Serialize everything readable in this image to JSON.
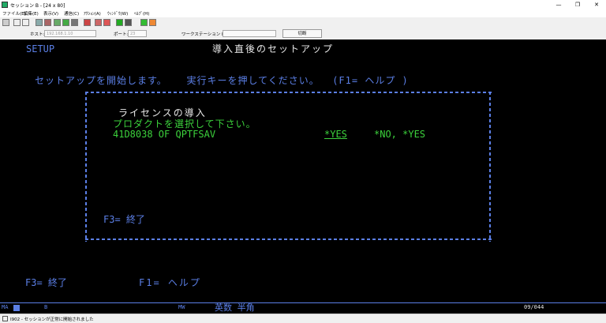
{
  "window": {
    "title": "セッション B - [24 x 80]"
  },
  "menu": [
    "ファイル(E)",
    "編集(E)",
    "表示(V)",
    "通信(C)",
    "ｱｸｼｮﾝ(A)",
    "ｳｨﾝﾄﾞｳ(W)",
    "ﾍﾙﾌﾟ(H)"
  ],
  "hostbar": {
    "host_label": "ホスト:",
    "host_value": "192.168.1.10",
    "port_label": "ポート:",
    "port_value": "23",
    "ws_label": "ワークステーション ID:",
    "ws_value": "",
    "disconnect_label": "切断"
  },
  "screen": {
    "setup": "SETUP",
    "heading": "導入直後のセットアップ",
    "instruction": "セットアップを開始します。   実行キーを押してください。  (F1= ヘルプ )",
    "dialog": {
      "title": "ライセンスの導入",
      "prompt": "プロダクトを選択して下さい。",
      "product": "41D8038 OF QPTFSAV",
      "value": "*YES",
      "options": "*NO, *YES",
      "f3": "F3= 終了"
    },
    "footer_f3": "F3= 終了",
    "footer_f1": "F1= ヘルプ"
  },
  "status": {
    "ma": "MA",
    "indicator": "B",
    "mw": "MW",
    "mode": "英数 半角",
    "cursor": "09/044"
  },
  "bottom": {
    "message": "I902 - セッションが正常に開始されました"
  }
}
